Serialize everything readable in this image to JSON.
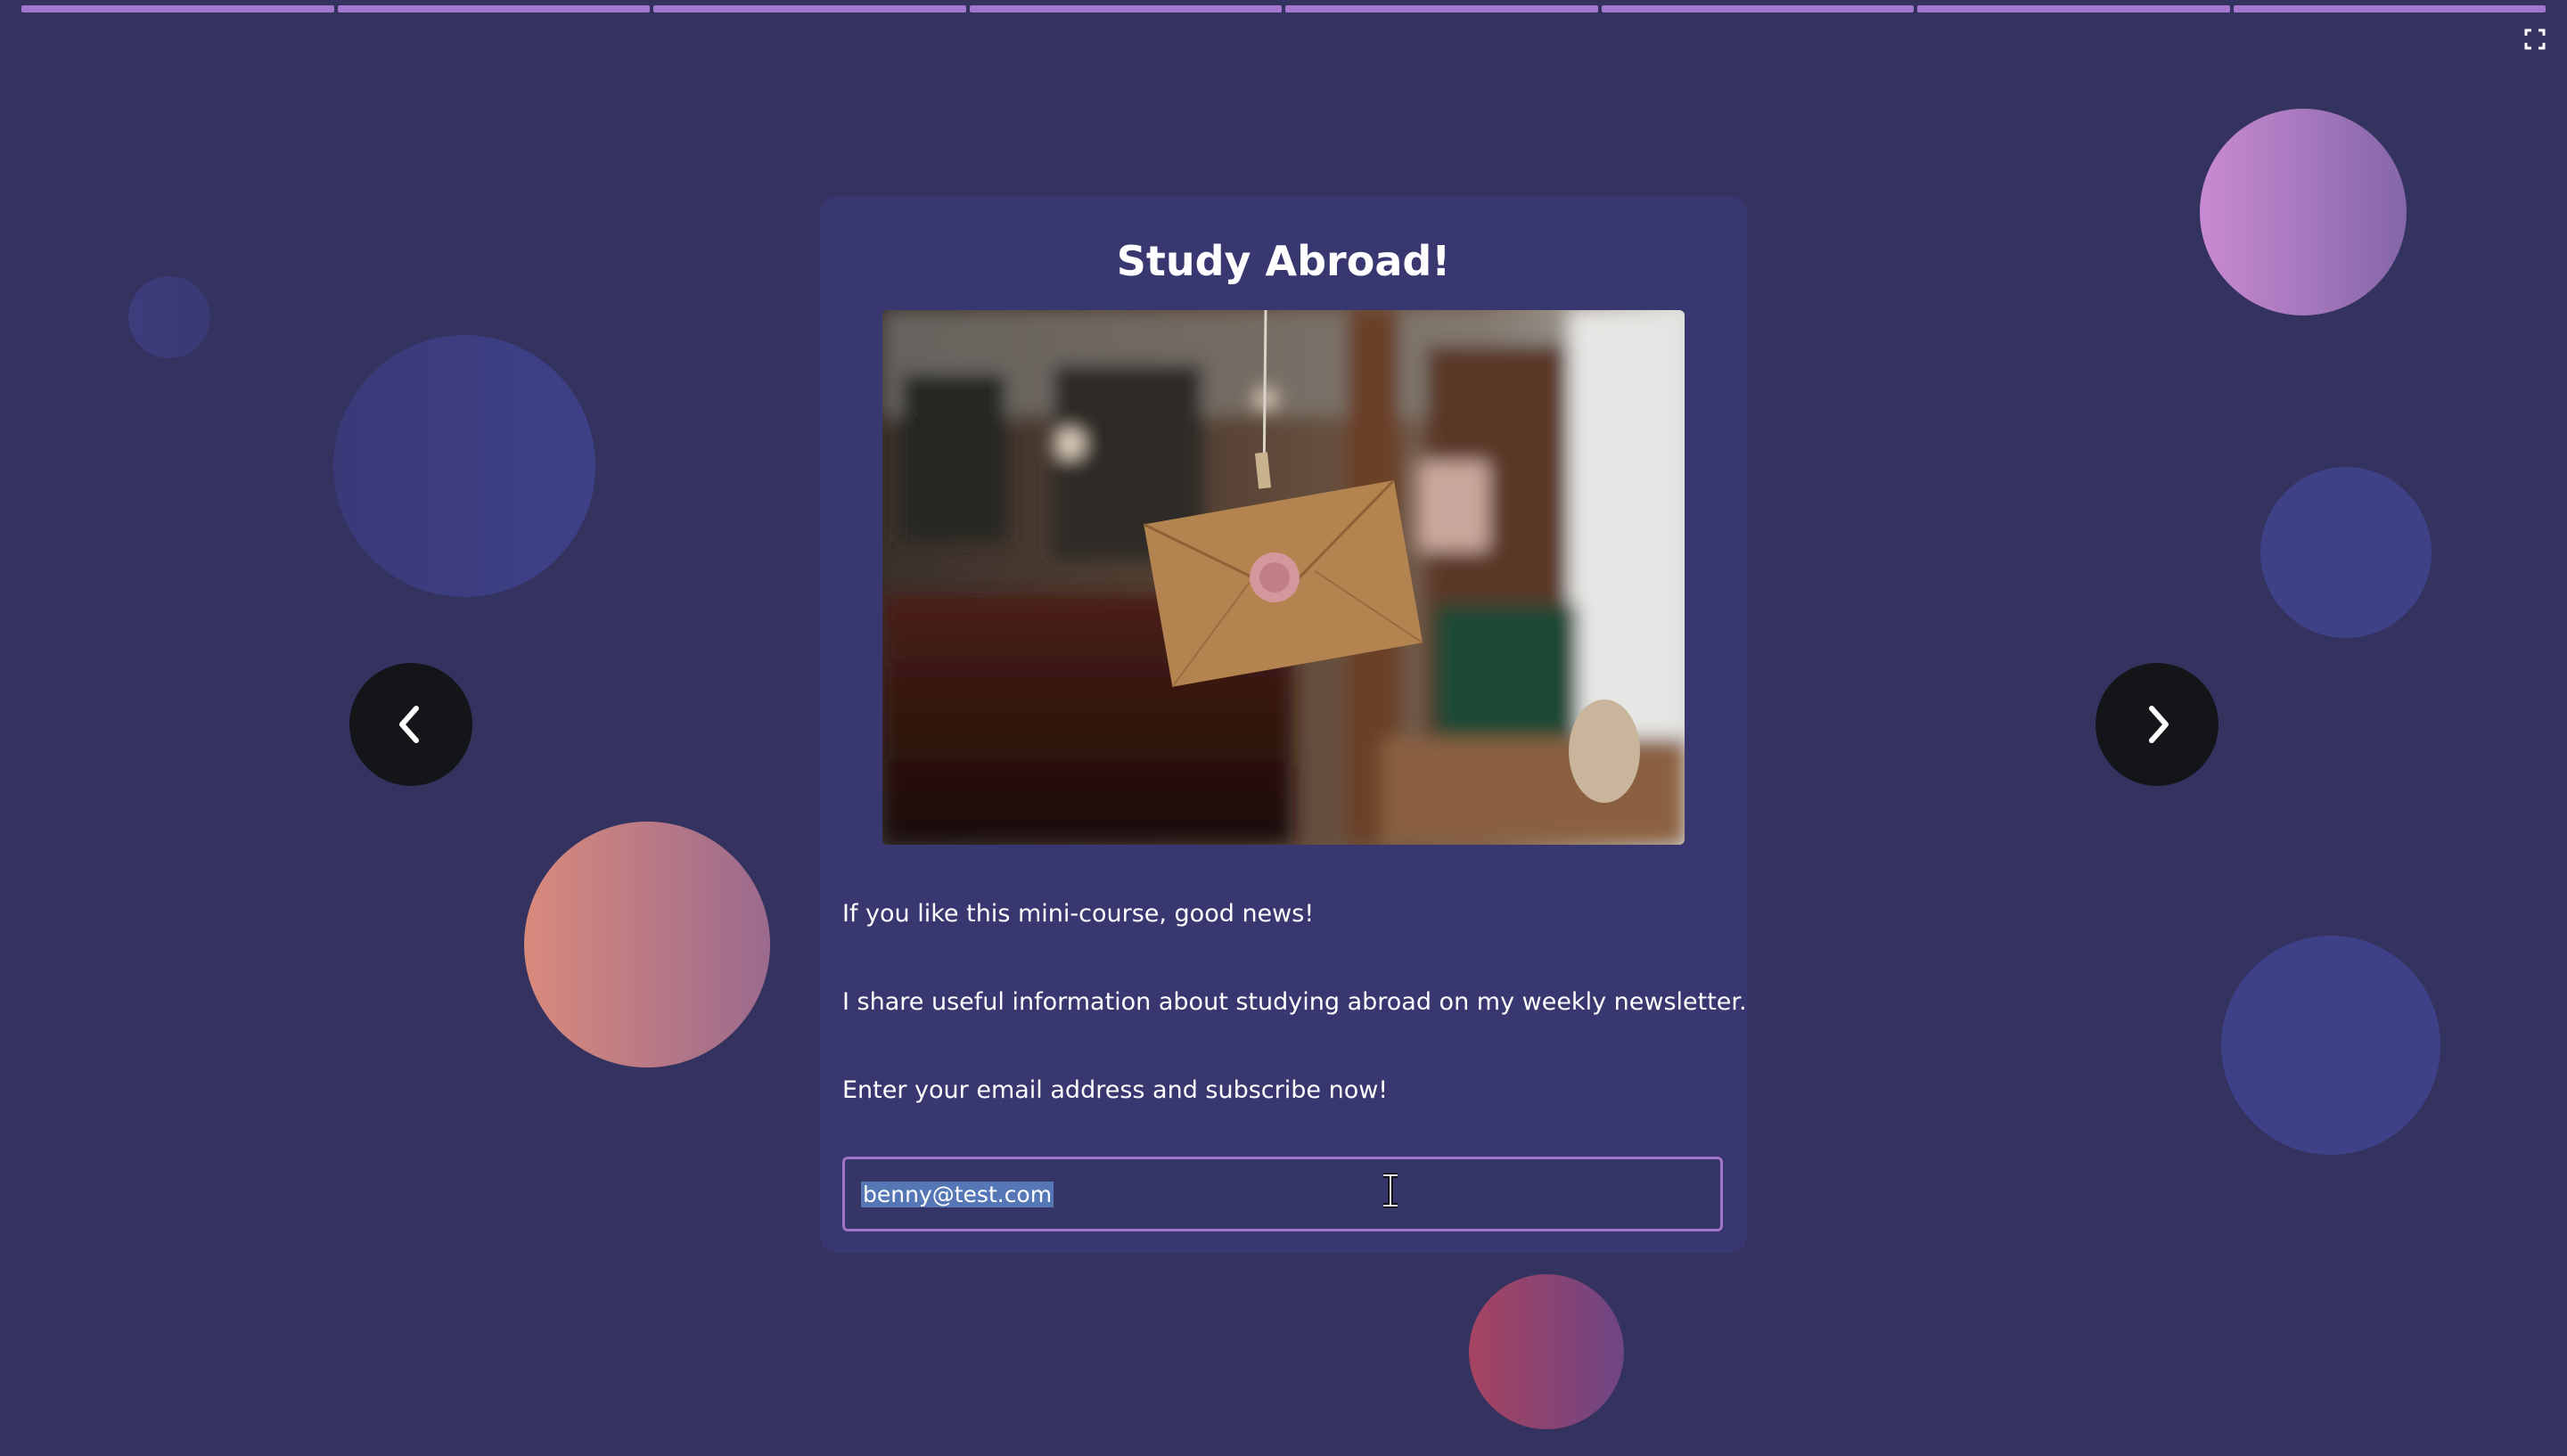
{
  "progress": {
    "segments_total": 8,
    "segments_completed": 8
  },
  "card": {
    "title": "Study Abroad!",
    "paragraphs": [
      "If you like this mini-course, good news!",
      "I share useful information about studying abroad on my weekly newsletter.",
      "Enter your email address and subscribe now!"
    ],
    "email_value": "benny@test.com"
  },
  "icons": {
    "fullscreen": "fullscreen-icon",
    "prev": "chevron-left-icon",
    "next": "chevron-right-icon",
    "cursor": "text-cursor-icon"
  },
  "colors": {
    "background": "#34325e",
    "card": "#383770",
    "accent": "#a377cd",
    "nav_button": "#141519",
    "selection": "#5577b6"
  }
}
